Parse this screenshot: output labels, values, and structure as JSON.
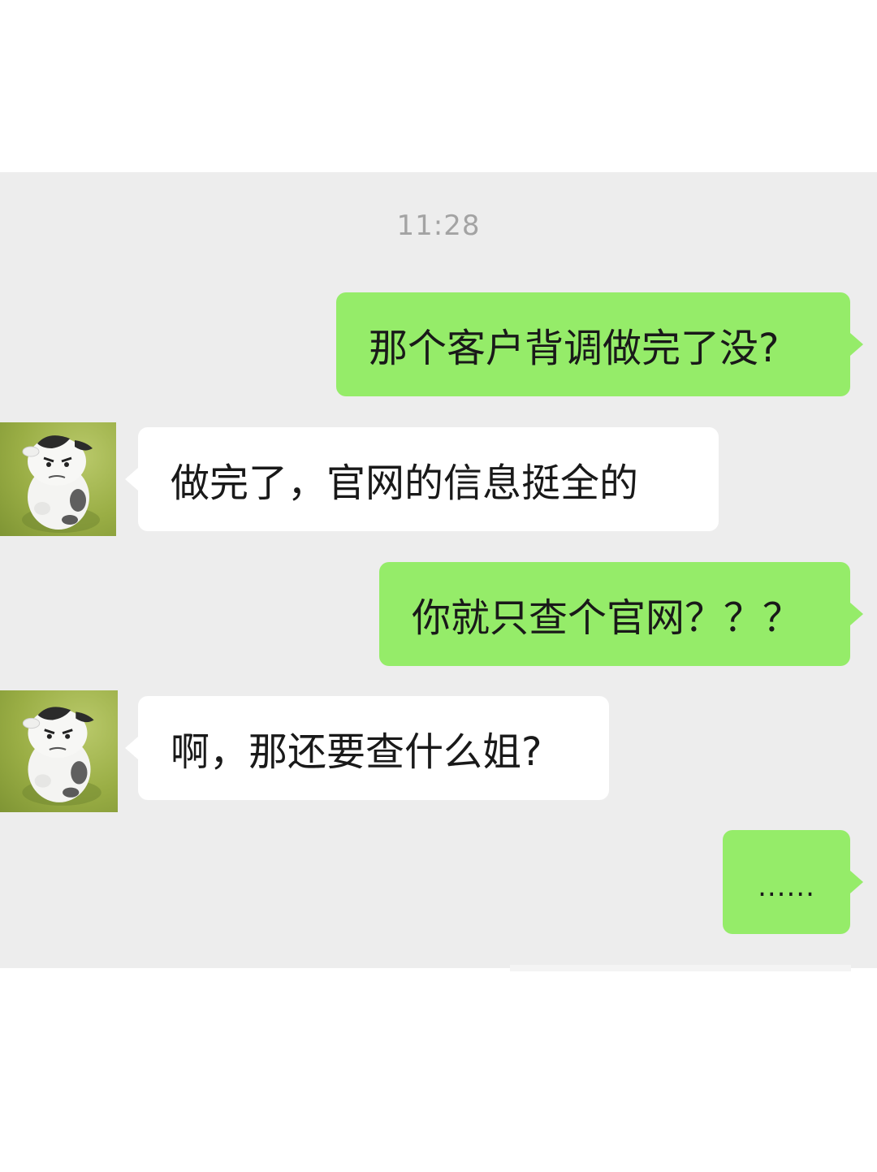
{
  "chat": {
    "timestamp": "11:28",
    "messages": [
      {
        "sender": "me",
        "text": "那个客户背调做完了没?"
      },
      {
        "sender": "other",
        "text": "做完了，官网的信息挺全的"
      },
      {
        "sender": "me",
        "text": "你就只查个官网？？？"
      },
      {
        "sender": "other",
        "text": "啊，那还要查什么姐?"
      },
      {
        "sender": "me",
        "text": "......"
      }
    ]
  },
  "colors": {
    "chat_background": "#ededed",
    "outgoing_bubble": "#95ec69",
    "incoming_bubble": "#ffffff",
    "timestamp_text": "#a3a3a3"
  },
  "icons": {
    "avatar": "cow-character-avatar-icon"
  }
}
